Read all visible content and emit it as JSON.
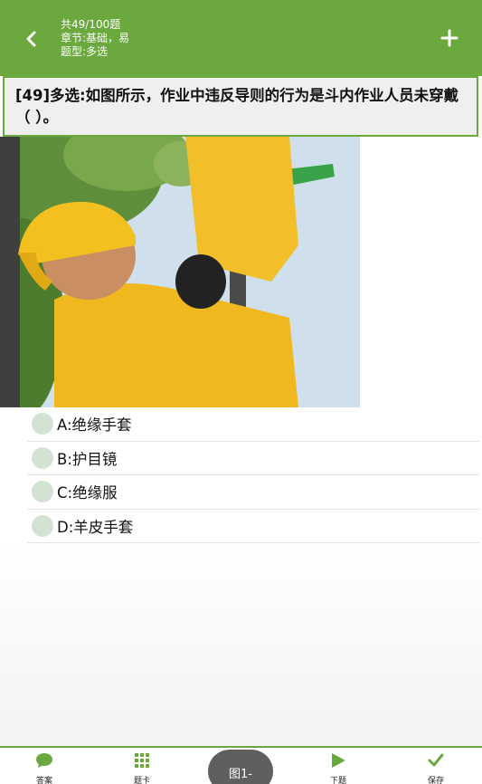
{
  "header": {
    "count_label": "共49/100题",
    "chapter_label": "章节:基础，易",
    "type_label": "题型:多选"
  },
  "question": {
    "text": "[49]多选:如图所示，作业中违反导则的行为是斗内作业人员未穿戴（ ）。"
  },
  "options": [
    {
      "label": "A:绝缘手套"
    },
    {
      "label": "B:护目镜"
    },
    {
      "label": "C:绝缘服"
    },
    {
      "label": "D:羊皮手套"
    }
  ],
  "bottom_bar": {
    "answer_label": "答案",
    "card_label": "题卡",
    "figure_label": "图1-",
    "next_label": "下题",
    "save_label": "保存"
  },
  "colors": {
    "accent": "#6ba83e",
    "question_bg": "#efefef",
    "radio": "#d3e3d3"
  },
  "icons": {
    "back": "chevron-left-icon",
    "add": "plus-icon",
    "answer": "chat-bubble-icon",
    "card": "grid-icon",
    "next": "play-icon",
    "save": "checkmark-icon"
  }
}
